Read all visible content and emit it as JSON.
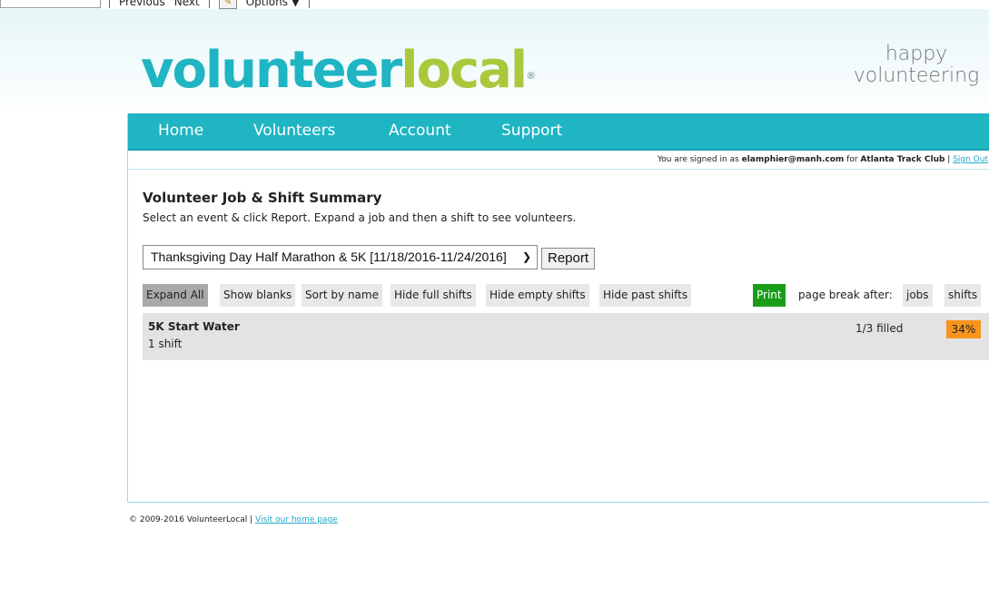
{
  "browser_bar": {
    "previous": "Previous",
    "next": "Next",
    "options": "Options ▼"
  },
  "brand": {
    "logo_part1": "volunteer",
    "logo_part2": "local",
    "registered": "®",
    "tagline_line1": "happy",
    "tagline_line2": "volunteering"
  },
  "nav": {
    "items": [
      "Home",
      "Volunteers",
      "Account",
      "Support"
    ]
  },
  "signed_in": {
    "prefix": "You are signed in as ",
    "email": "elamphier@manh.com",
    "middle": " for ",
    "org": "Atlanta Track Club",
    "separator": " | ",
    "sign_out": "Sign Out"
  },
  "page": {
    "title": "Volunteer Job & Shift Summary",
    "subtitle": "Select an event & click Report. Expand a job and then a shift to see volunteers."
  },
  "event_select": {
    "selected": "Thanksgiving Day Half Marathon & 5K [11/18/2016-11/24/2016]"
  },
  "report_button": "Report",
  "toolbar": {
    "expand_all": "Expand All",
    "show_blanks": "Show blanks",
    "sort_by_name": "Sort by name",
    "hide_full": "Hide full shifts",
    "hide_empty": "Hide empty shifts",
    "hide_past": "Hide past shifts",
    "print": "Print",
    "page_break_label": "page break after:",
    "jobs": "jobs",
    "shifts": "shifts"
  },
  "jobs": [
    {
      "name": "5K Start Water",
      "shift_count": "1 shift",
      "filled": "1/3 filled",
      "percent": "34%"
    }
  ],
  "colors": {
    "brand_teal": "#1fb5c3",
    "brand_green": "#a9c83b",
    "print_green": "#1a9e1a",
    "percent_orange": "#f7941d"
  },
  "footer": {
    "copyright": "© 2009-2016 VolunteerLocal",
    "separator": " | ",
    "home_link": "Visit our home page"
  }
}
